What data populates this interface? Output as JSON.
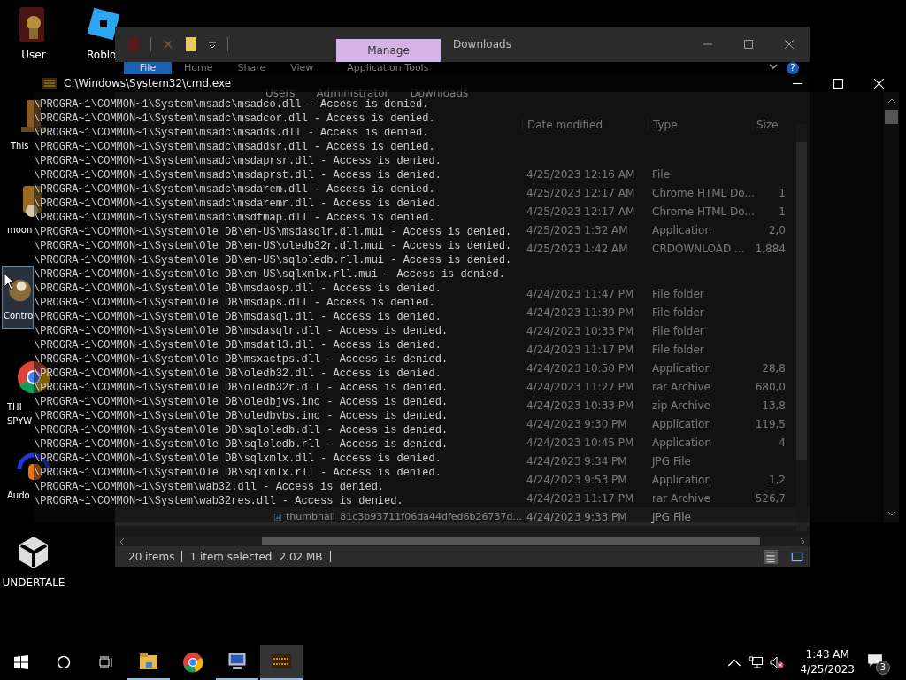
{
  "desktop_icons": [
    {
      "lines": [
        "User"
      ],
      "selected": false
    },
    {
      "lines": [
        "Roblo"
      ],
      "selected": false
    },
    {
      "lines": [
        "This"
      ],
      "selected": false
    },
    {
      "lines": [
        "moon"
      ],
      "selected": false
    },
    {
      "lines": [
        "Contro"
      ],
      "selected": true
    },
    {
      "lines": [
        "THI",
        "SPYW"
      ],
      "selected": false
    },
    {
      "lines": [
        "Audo"
      ],
      "selected": false
    },
    {
      "lines": [
        "UNDERTALE"
      ],
      "selected": false
    }
  ],
  "explorer": {
    "title": "Downloads",
    "context_tab": "Manage",
    "ribbon_tabs": [
      {
        "label": "File",
        "kind": "file"
      },
      {
        "label": "Home",
        "kind": "tab"
      },
      {
        "label": "Share",
        "kind": "tab"
      },
      {
        "label": "View",
        "kind": "tab"
      },
      {
        "label": "Application Tools",
        "kind": "context"
      }
    ],
    "help": "?",
    "breadcrumb": [
      "Users",
      "Administrator",
      "Downloads"
    ],
    "columns": [
      "Date modified",
      "Type",
      "Size"
    ],
    "groups": [
      {
        "rows": [
          {
            "date": "4/25/2023 12:16 AM",
            "type": "File",
            "selected": false
          },
          {
            "date": "4/25/2023 12:17 AM",
            "type": "Chrome HTML Do...",
            "size": "1",
            "selected": false
          },
          {
            "date": "4/25/2023 12:17 AM",
            "type": "Chrome HTML Do...",
            "size": "1",
            "selected": false
          },
          {
            "date": "4/25/2023 1:32 AM",
            "type": "Application",
            "size": "2,0",
            "selected": false
          },
          {
            "date": "4/25/2023 1:42 AM",
            "type": "CRDOWNLOAD ...",
            "size": "1,884",
            "selected": false
          }
        ]
      },
      {
        "rows": [
          {
            "date": "4/24/2023 11:47 PM",
            "type": "File folder",
            "selected": false
          },
          {
            "date": "4/24/2023 11:39 PM",
            "type": "File folder",
            "selected": false
          },
          {
            "date": "4/24/2023 10:33 PM",
            "type": "File folder",
            "selected": false
          },
          {
            "date": "4/24/2023 11:17 PM",
            "type": "File folder",
            "selected": false
          },
          {
            "date": "4/24/2023 10:50 PM",
            "type": "Application",
            "size": "28,8",
            "selected": false
          },
          {
            "date": "4/24/2023 11:27 PM",
            "type": "rar Archive",
            "size": "680,0",
            "selected": false
          },
          {
            "date": "4/24/2023 10:33 PM",
            "type": "zip Archive",
            "size": "13,8",
            "selected": false
          },
          {
            "date": "4/24/2023 9:30 PM",
            "type": "Application",
            "size": "119,5",
            "selected": false
          },
          {
            "date": "4/24/2023 10:45 PM",
            "type": "Application",
            "size": "4",
            "selected": false
          },
          {
            "date": "4/24/2023 9:34 PM",
            "type": "JPG File",
            "selected": false
          },
          {
            "date": "4/24/2023 9:53 PM",
            "type": "Application",
            "size": "1,2",
            "selected": false
          },
          {
            "date": "4/24/2023 11:17 PM",
            "type": "rar Archive",
            "size": "526,7",
            "selected": false
          },
          {
            "name": "thumbnail_81c3b93711f06da44dfed6b26737d...",
            "date": "4/24/2023 9:33 PM",
            "type": "JPG File",
            "selected": true
          }
        ]
      }
    ],
    "status": {
      "count": "20 items",
      "selection": "1 item selected",
      "size": "2.02 MB"
    }
  },
  "cmd": {
    "title": "C:\\Windows\\System32\\cmd.exe",
    "lines": [
      "\\PROGRA~1\\COMMON~1\\System\\msadc\\msadco.dll - Access is denied.",
      "\\PROGRA~1\\COMMON~1\\System\\msadc\\msadcor.dll - Access is denied.",
      "\\PROGRA~1\\COMMON~1\\System\\msadc\\msadds.dll - Access is denied.",
      "\\PROGRA~1\\COMMON~1\\System\\msadc\\msaddsr.dll - Access is denied.",
      "\\PROGRA~1\\COMMON~1\\System\\msadc\\msdaprsr.dll - Access is denied.",
      "\\PROGRA~1\\COMMON~1\\System\\msadc\\msdaprst.dll - Access is denied.",
      "\\PROGRA~1\\COMMON~1\\System\\msadc\\msdarem.dll - Access is denied.",
      "\\PROGRA~1\\COMMON~1\\System\\msadc\\msdaremr.dll - Access is denied.",
      "\\PROGRA~1\\COMMON~1\\System\\msadc\\msdfmap.dll - Access is denied.",
      "\\PROGRA~1\\COMMON~1\\System\\Ole DB\\en-US\\msdasqlr.dll.mui - Access is denied.",
      "\\PROGRA~1\\COMMON~1\\System\\Ole DB\\en-US\\oledb32r.dll.mui - Access is denied.",
      "\\PROGRA~1\\COMMON~1\\System\\Ole DB\\en-US\\sqloledb.rll.mui - Access is denied.",
      "\\PROGRA~1\\COMMON~1\\System\\Ole DB\\en-US\\sqlxmlx.rll.mui - Access is denied.",
      "\\PROGRA~1\\COMMON~1\\System\\Ole DB\\msdaosp.dll - Access is denied.",
      "\\PROGRA~1\\COMMON~1\\System\\Ole DB\\msdaps.dll - Access is denied.",
      "\\PROGRA~1\\COMMON~1\\System\\Ole DB\\msdasql.dll - Access is denied.",
      "\\PROGRA~1\\COMMON~1\\System\\Ole DB\\msdasqlr.dll - Access is denied.",
      "\\PROGRA~1\\COMMON~1\\System\\Ole DB\\msdatl3.dll - Access is denied.",
      "\\PROGRA~1\\COMMON~1\\System\\Ole DB\\msxactps.dll - Access is denied.",
      "\\PROGRA~1\\COMMON~1\\System\\Ole DB\\oledb32.dll - Access is denied.",
      "\\PROGRA~1\\COMMON~1\\System\\Ole DB\\oledb32r.dll - Access is denied.",
      "\\PROGRA~1\\COMMON~1\\System\\Ole DB\\oledbjvs.inc - Access is denied.",
      "\\PROGRA~1\\COMMON~1\\System\\Ole DB\\oledbvbs.inc - Access is denied.",
      "\\PROGRA~1\\COMMON~1\\System\\Ole DB\\sqloledb.dll - Access is denied.",
      "\\PROGRA~1\\COMMON~1\\System\\Ole DB\\sqloledb.rll - Access is denied.",
      "\\PROGRA~1\\COMMON~1\\System\\Ole DB\\sqlxmlx.dll - Access is denied.",
      "\\PROGRA~1\\COMMON~1\\System\\Ole DB\\sqlxmlx.rll - Access is denied.",
      "\\PROGRA~1\\COMMON~1\\System\\wab32.dll - Access is denied.",
      "\\PROGRA~1\\COMMON~1\\System\\wab32res.dll - Access is denied."
    ]
  },
  "taskbar": {
    "apps": [
      {
        "running": true,
        "active": false
      },
      {
        "running": false,
        "active": false
      },
      {
        "running": true,
        "active": false
      },
      {
        "running": true,
        "active": true
      }
    ],
    "clock": {
      "time": "1:43 AM",
      "date": "4/25/2023"
    },
    "notifications": "3"
  }
}
